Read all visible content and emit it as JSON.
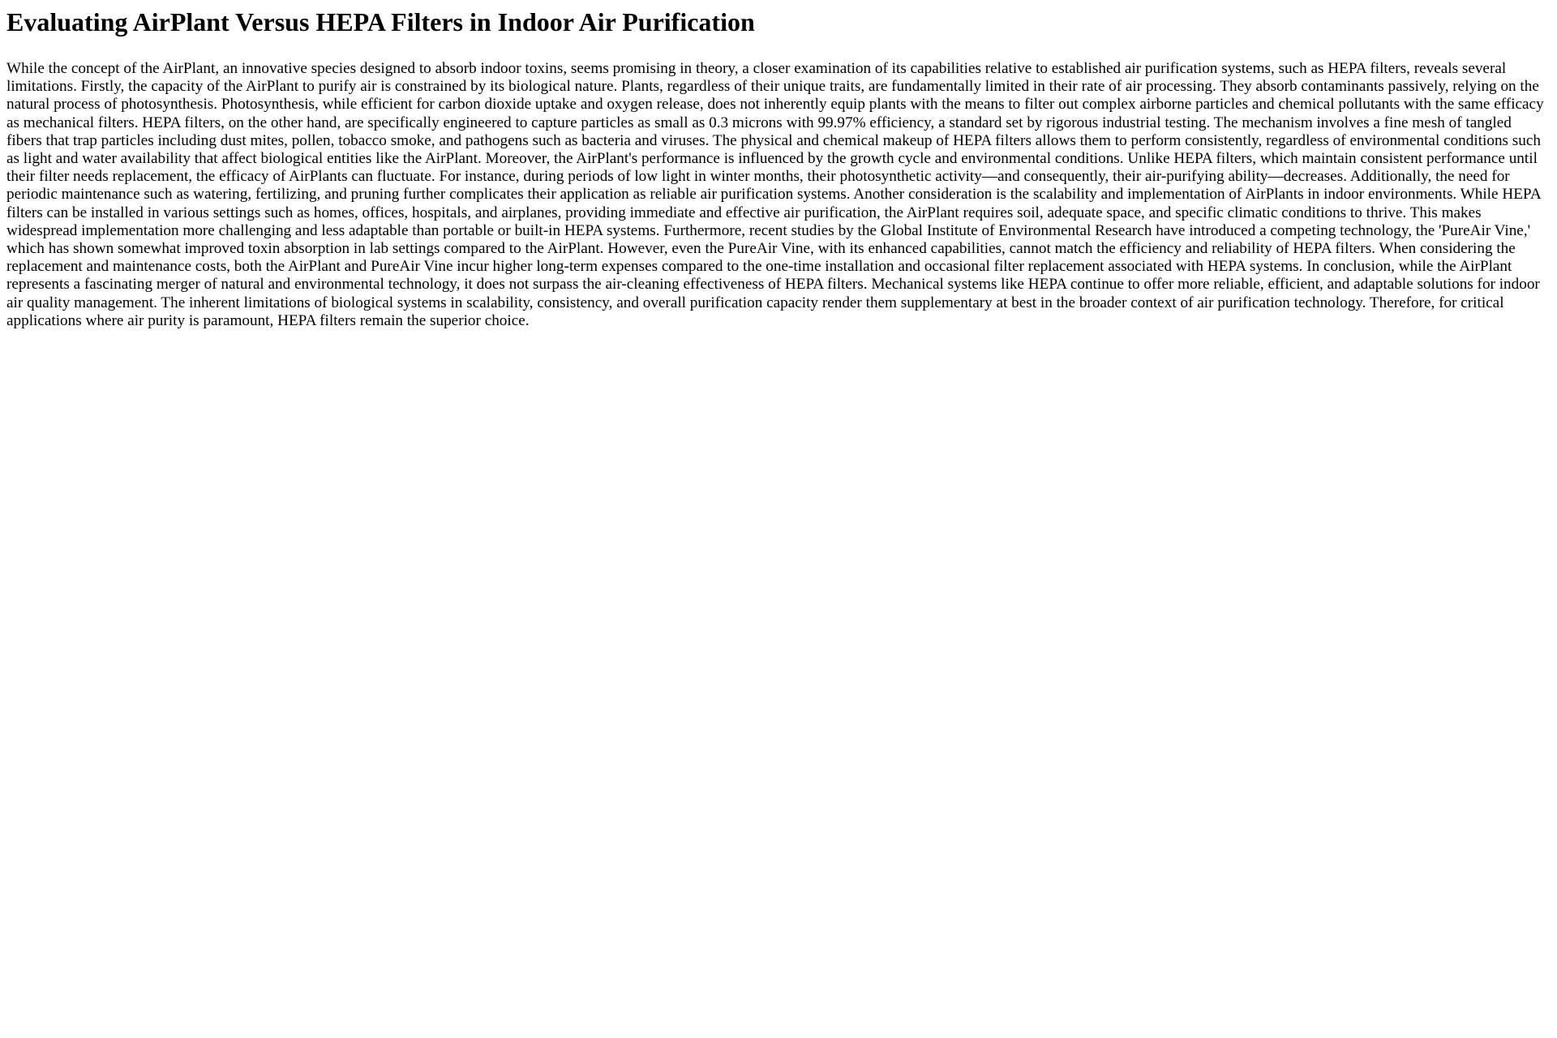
{
  "document": {
    "title": "Evaluating AirPlant Versus HEPA Filters in Indoor Air Purification",
    "body": "While the concept of the AirPlant, an innovative species designed to absorb indoor toxins, seems promising in theory, a closer examination of its capabilities relative to established air purification systems, such as HEPA filters, reveals several limitations. Firstly, the capacity of the AirPlant to purify air is constrained by its biological nature. Plants, regardless of their unique traits, are fundamentally limited in their rate of air processing. They absorb contaminants passively, relying on the natural process of photosynthesis. Photosynthesis, while efficient for carbon dioxide uptake and oxygen release, does not inherently equip plants with the means to filter out complex airborne particles and chemical pollutants with the same efficacy as mechanical filters. HEPA filters, on the other hand, are specifically engineered to capture particles as small as 0.3 microns with 99.97% efficiency, a standard set by rigorous industrial testing. The mechanism involves a fine mesh of tangled fibers that trap particles including dust mites, pollen, tobacco smoke, and pathogens such as bacteria and viruses. The physical and chemical makeup of HEPA filters allows them to perform consistently, regardless of environmental conditions such as light and water availability that affect biological entities like the AirPlant. Moreover, the AirPlant's performance is influenced by the growth cycle and environmental conditions. Unlike HEPA filters, which maintain consistent performance until their filter needs replacement, the efficacy of AirPlants can fluctuate. For instance, during periods of low light in winter months, their photosynthetic activity—and consequently, their air-purifying ability—decreases. Additionally, the need for periodic maintenance such as watering, fertilizing, and pruning further complicates their application as reliable air purification systems. Another consideration is the scalability and implementation of AirPlants in indoor environments. While HEPA filters can be installed in various settings such as homes, offices, hospitals, and airplanes, providing immediate and effective air purification, the AirPlant requires soil, adequate space, and specific climatic conditions to thrive. This makes widespread implementation more challenging and less adaptable than portable or built-in HEPA systems. Furthermore, recent studies by the Global Institute of Environmental Research have introduced a competing technology, the 'PureAir Vine,' which has shown somewhat improved toxin absorption in lab settings compared to the AirPlant. However, even the PureAir Vine, with its enhanced capabilities, cannot match the efficiency and reliability of HEPA filters. When considering the replacement and maintenance costs, both the AirPlant and PureAir Vine incur higher long-term expenses compared to the one-time installation and occasional filter replacement associated with HEPA systems. In conclusion, while the AirPlant represents a fascinating merger of natural and environmental technology, it does not surpass the air-cleaning effectiveness of HEPA filters. Mechanical systems like HEPA continue to offer more reliable, efficient, and adaptable solutions for indoor air quality management. The inherent limitations of biological systems in scalability, consistency, and overall purification capacity render them supplementary at best in the broader context of air purification technology. Therefore, for critical applications where air purity is paramount, HEPA filters remain the superior choice."
  }
}
